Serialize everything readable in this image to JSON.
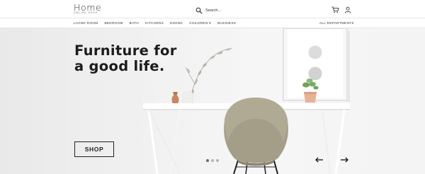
{
  "header": {
    "logo_word": "Home",
    "logo_tagline": "ONLINE SHOP",
    "search_placeholder": "Search..."
  },
  "nav": {
    "items": [
      "LIVING ROOM",
      "BEDROOM",
      "BATH",
      "KITCHENS",
      "DINING",
      "CHILDREN'S",
      "BUSINESS"
    ],
    "all_departments": "ALL DEPARTMENTS"
  },
  "hero": {
    "headline_line1": "Furniture for",
    "headline_line2": "a good life.",
    "cta_label": "SHOP",
    "slide_count": 3,
    "active_slide": 1
  },
  "icons": {
    "search": "search-icon",
    "cart": "cart-icon",
    "account": "user-icon",
    "prev": "arrow-left-icon",
    "next": "arrow-right-icon"
  },
  "colors": {
    "text": "#222222",
    "hero_bg": "#f1f1f1",
    "chair": "#a39d88",
    "vase_copper": "#cf8a5e"
  }
}
